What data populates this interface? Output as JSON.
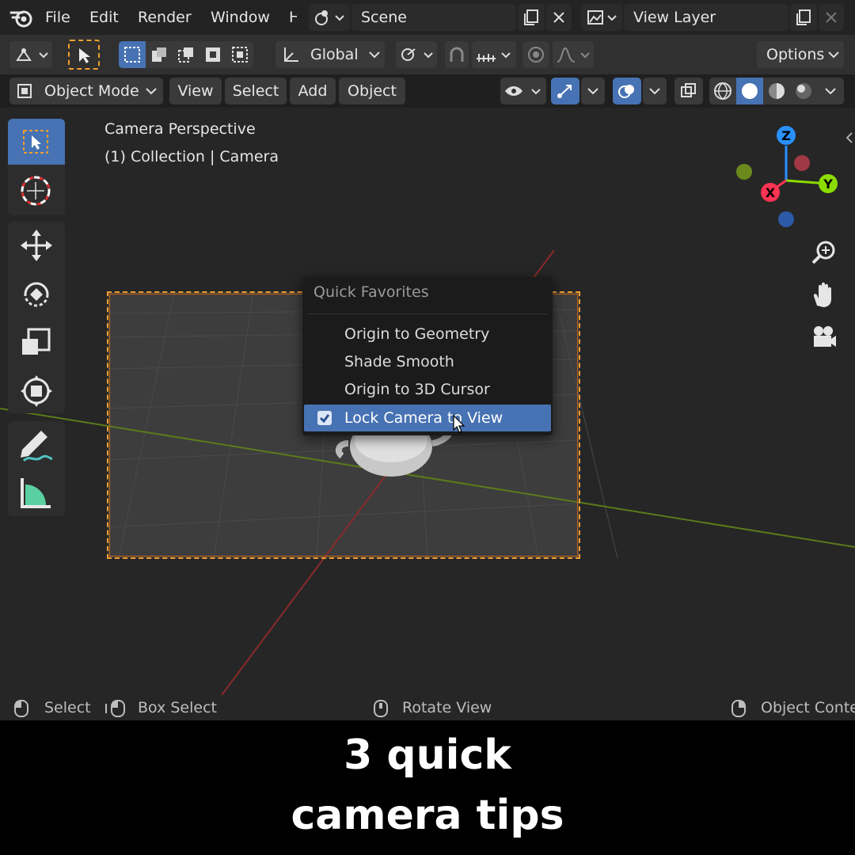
{
  "menubar": {
    "items": [
      "File",
      "Edit",
      "Render",
      "Window",
      "H"
    ],
    "scene": "Scene",
    "view_layer": "View Layer"
  },
  "toolbar": {
    "transform_orientation": "Global",
    "options": "Options"
  },
  "view_header": {
    "mode": "Object Mode",
    "menus": [
      "View",
      "Select",
      "Add",
      "Object"
    ]
  },
  "viewport": {
    "camera_label": "Camera Perspective",
    "collection_label": "(1) Collection | Camera",
    "gizmo": {
      "x": "X",
      "y": "Y",
      "z": "Z"
    }
  },
  "popup": {
    "title": "Quick Favorites",
    "items": [
      {
        "label": "Origin to Geometry"
      },
      {
        "label": "Shade Smooth"
      },
      {
        "label": "Origin to 3D Cursor"
      },
      {
        "label": "Lock Camera to View",
        "checked": true
      }
    ]
  },
  "statusbar": {
    "select": "Select",
    "box_select": "Box Select",
    "rotate_view": "Rotate View",
    "object_context": "Object Conte"
  },
  "caption": {
    "line1": "3 quick",
    "line2": "camera tips"
  },
  "colors": {
    "accent": "#4772b3",
    "camera_frame": "#f0a030",
    "x_axis": "#ff3352",
    "y_axis": "#8bdc00",
    "z_axis": "#2890ff"
  },
  "icons": [
    "blender-logo-icon",
    "scene-icon",
    "copy-icon",
    "close-icon",
    "image-icon",
    "transform-pivot-icon",
    "snap-icon",
    "proportional-edit-icon",
    "visibility-icon",
    "gizmo-icon",
    "overlay-icon",
    "xray-icon",
    "wireframe-shading-icon",
    "solid-shading-icon",
    "material-shading-icon",
    "rendered-shading-icon",
    "select-box-icon",
    "cursor-icon",
    "move-icon",
    "rotate-icon",
    "scale-icon",
    "transform-icon",
    "annotate-icon",
    "measure-icon",
    "zoom-icon",
    "hand-icon",
    "camera-icon",
    "checkbox-icon",
    "mouse-icon"
  ]
}
